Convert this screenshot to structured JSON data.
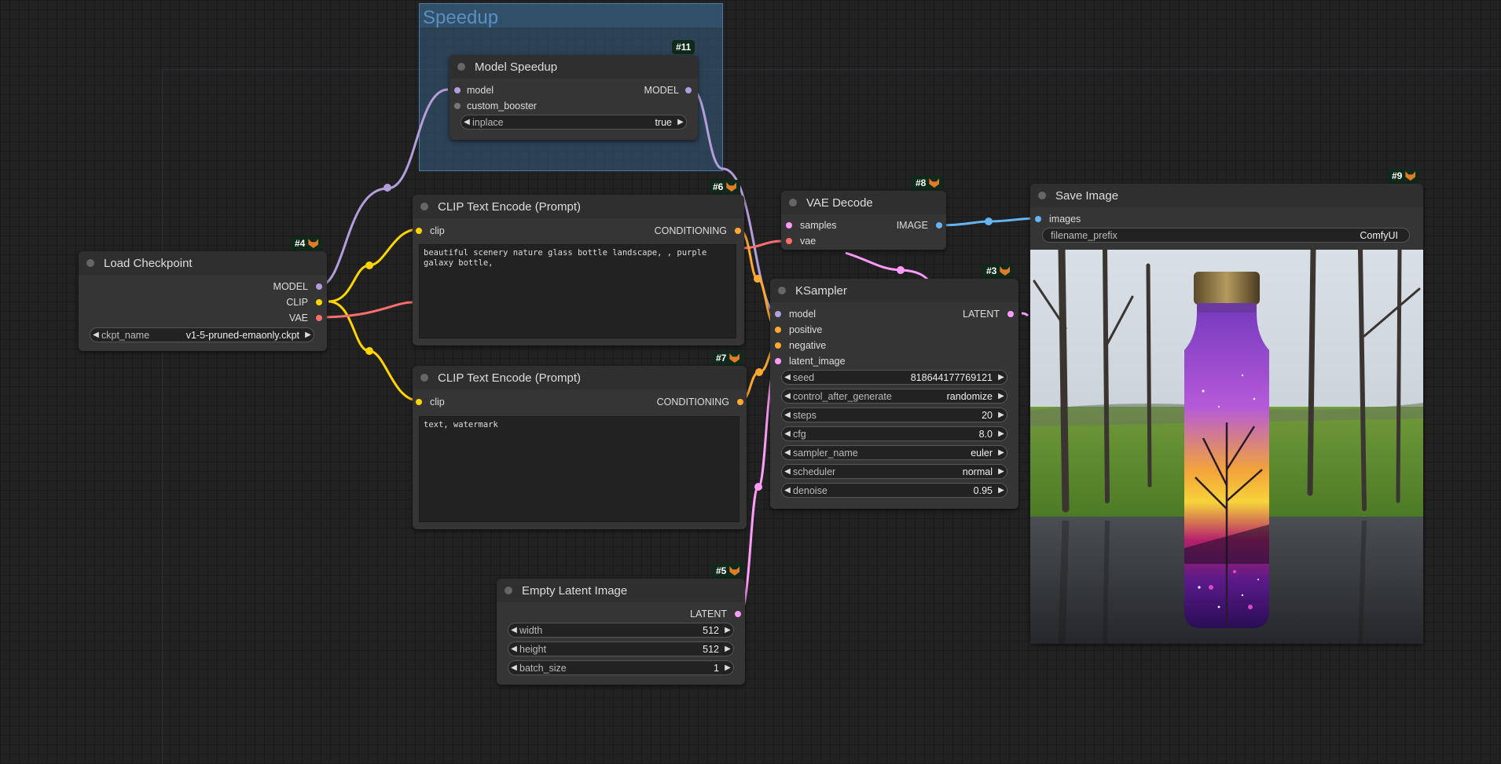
{
  "colors": {
    "model": "#b39ddb",
    "clip": "#ffd500",
    "vae": "#ff6e6e",
    "conditioning": "#ffa931",
    "latent": "#ff9cf9",
    "image": "#64b5f6"
  },
  "group": {
    "title": "Speedup"
  },
  "nodes": {
    "model_speedup": {
      "id": "#11",
      "title": "Model Speedup",
      "in_model": "model",
      "in_booster": "custom_booster",
      "out_model": "MODEL",
      "w_inplace_label": "inplace",
      "w_inplace_value": "true"
    },
    "clip_pos": {
      "id": "#6",
      "title": "CLIP Text Encode (Prompt)",
      "in_clip": "clip",
      "out": "CONDITIONING",
      "text": "beautiful scenery nature glass bottle landscape, , purple galaxy bottle,"
    },
    "clip_neg": {
      "id": "#7",
      "title": "CLIP Text Encode (Prompt)",
      "in_clip": "clip",
      "out": "CONDITIONING",
      "text": "text, watermark"
    },
    "checkpoint": {
      "id": "#4",
      "title": "Load Checkpoint",
      "out_model": "MODEL",
      "out_clip": "CLIP",
      "out_vae": "VAE",
      "w_label": "ckpt_name",
      "w_value": "v1-5-pruned-emaonly.ckpt"
    },
    "vae_decode": {
      "id": "#8",
      "title": "VAE Decode",
      "in_samples": "samples",
      "in_vae": "vae",
      "out": "IMAGE"
    },
    "ksampler": {
      "id": "#3",
      "title": "KSampler",
      "in_model": "model",
      "in_positive": "positive",
      "in_negative": "negative",
      "in_latent": "latent_image",
      "out": "LATENT",
      "widgets": [
        {
          "label": "seed",
          "value": "818644177769121"
        },
        {
          "label": "control_after_generate",
          "value": "randomize"
        },
        {
          "label": "steps",
          "value": "20"
        },
        {
          "label": "cfg",
          "value": "8.0"
        },
        {
          "label": "sampler_name",
          "value": "euler"
        },
        {
          "label": "scheduler",
          "value": "normal"
        },
        {
          "label": "denoise",
          "value": "0.95"
        }
      ]
    },
    "empty_latent": {
      "id": "#5",
      "title": "Empty Latent Image",
      "out": "LATENT",
      "widgets": [
        {
          "label": "width",
          "value": "512"
        },
        {
          "label": "height",
          "value": "512"
        },
        {
          "label": "batch_size",
          "value": "1"
        }
      ]
    },
    "save_image": {
      "id": "#9",
      "title": "Save Image",
      "in_images": "images",
      "w_label": "filename_prefix",
      "w_value": "ComfyUI"
    }
  }
}
